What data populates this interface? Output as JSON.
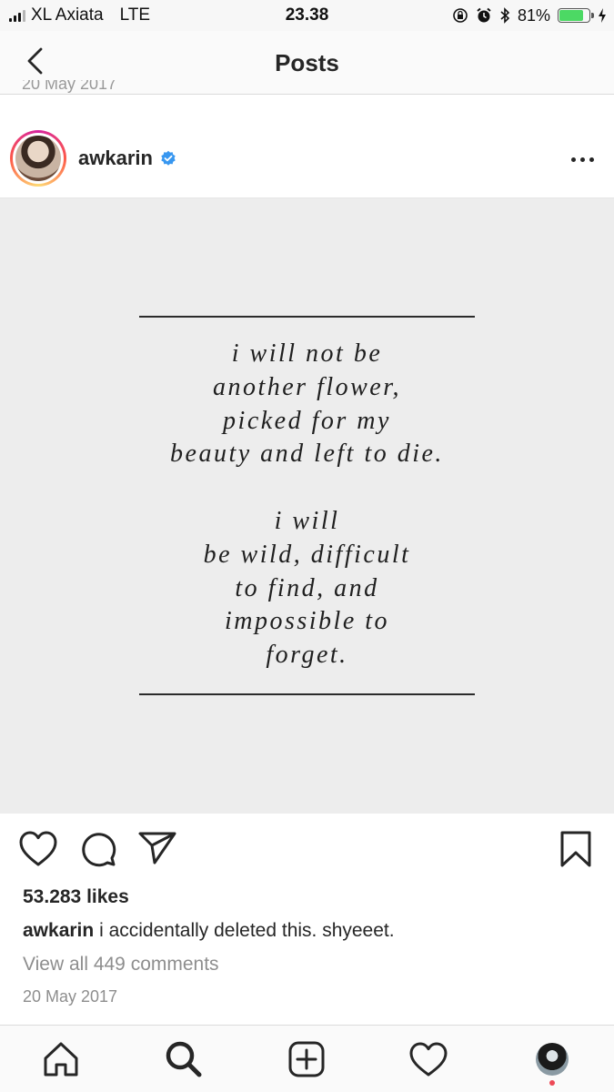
{
  "status_bar": {
    "carrier": "XL Axiata",
    "network": "LTE",
    "time": "23.38",
    "battery_percent": "81%",
    "battery_level": 0.81,
    "icons": [
      "rotation-lock-icon",
      "alarm-icon",
      "bluetooth-icon",
      "battery-icon",
      "charging-icon"
    ]
  },
  "nav": {
    "title": "Posts",
    "back_icon": "chevron-left-icon"
  },
  "post": {
    "previous_post_date_fragment": "20 May 2017",
    "username": "awkarin",
    "verified": true,
    "image_text": {
      "stanza1": [
        "i will not be",
        "another flower,",
        "picked for my",
        "beauty and left to die."
      ],
      "stanza2": [
        "i will",
        "be wild, difficult",
        "to find, and",
        "impossible to",
        "forget."
      ]
    },
    "likes": "53.283 likes",
    "caption_username": "awkarin",
    "caption_text": "i accidentally deleted this. shyeeet.",
    "view_comments": "View all 449 comments",
    "date": "20 May 2017"
  },
  "actions": [
    "heart-icon",
    "comment-icon",
    "share-icon",
    "bookmark-icon"
  ],
  "tab_bar": [
    "home-icon",
    "search-icon",
    "new-post-icon",
    "activity-icon",
    "profile-avatar"
  ],
  "colors": {
    "verified_blue": "#3897f0",
    "notification_red": "#ed4956",
    "battery_green": "#4cd964"
  }
}
